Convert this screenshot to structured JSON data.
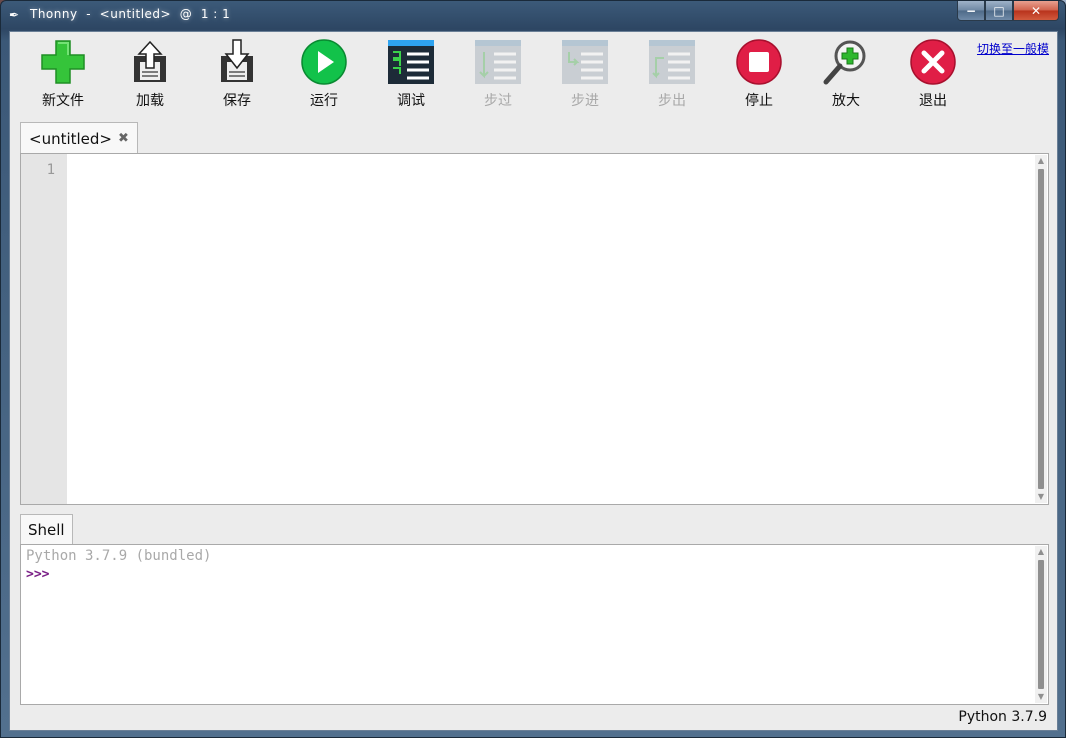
{
  "window": {
    "app_icon": "quill-icon",
    "title": "Thonny  -  <untitled>  @  1 : 1",
    "controls": {
      "minimize": "−",
      "maximize": "□",
      "close": "✕"
    }
  },
  "toolbar": {
    "buttons": [
      {
        "label": "新文件",
        "icon": "new-file-icon",
        "enabled": true
      },
      {
        "label": "加载",
        "icon": "load-icon",
        "enabled": true
      },
      {
        "label": "保存",
        "icon": "save-icon",
        "enabled": true
      },
      {
        "label": "运行",
        "icon": "run-icon",
        "enabled": true
      },
      {
        "label": "调试",
        "icon": "debug-icon",
        "enabled": true
      },
      {
        "label": "步过",
        "icon": "step-over-icon",
        "enabled": false
      },
      {
        "label": "步进",
        "icon": "step-into-icon",
        "enabled": false
      },
      {
        "label": "步出",
        "icon": "step-out-icon",
        "enabled": false
      },
      {
        "label": "停止",
        "icon": "stop-icon",
        "enabled": true
      },
      {
        "label": "放大",
        "icon": "zoom-icon",
        "enabled": true
      },
      {
        "label": "退出",
        "icon": "exit-icon",
        "enabled": true
      }
    ],
    "mode_link": "切换至一般模"
  },
  "editor": {
    "tab_label": "<untitled>",
    "tab_close": "✖",
    "line_numbers": [
      "1"
    ]
  },
  "shell": {
    "tab_label": "Shell",
    "banner": "Python 3.7.9 (bundled)",
    "prompt": ">>>"
  },
  "status": {
    "interpreter": "Python 3.7.9"
  },
  "colors": {
    "prompt": "#7a1f86",
    "run_green": "#12c24a",
    "stop_red": "#e01e46",
    "link": "#0000cc"
  }
}
